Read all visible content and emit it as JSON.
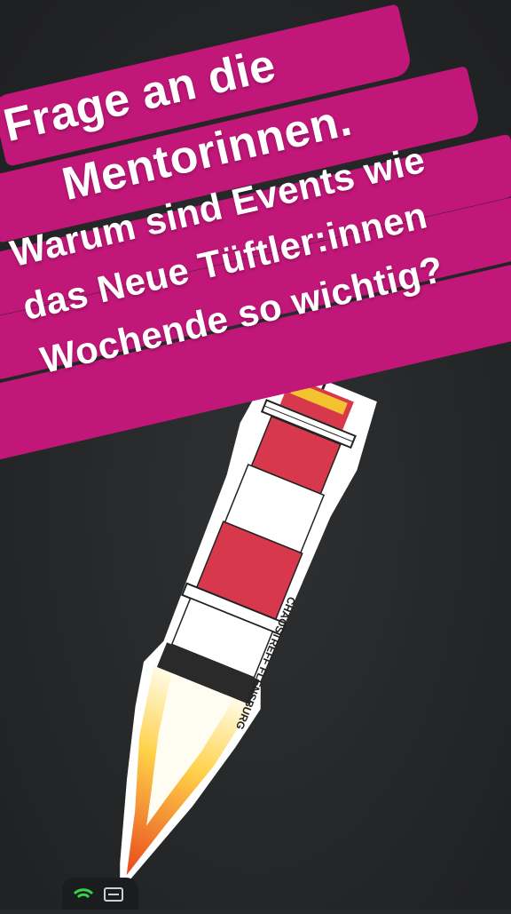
{
  "caption": {
    "title_line_1": "Frage an die",
    "title_line_2": "Mentorinnen.",
    "question_line_1": "Warum sind Events wie",
    "question_line_2": "das Neue Tüftler:innen",
    "question_line_3": "Wochende so wichtig?"
  },
  "sticker": {
    "icon": "rocket-lighthouse-sticker",
    "side_text": "CHAOSTREFF FLENSBURG"
  },
  "device_icons": {
    "left": "wifi-icon",
    "right": "screen-cast-icon"
  },
  "colors": {
    "brush": "#c01778",
    "background": "#26282a",
    "flame": "#f28a1e",
    "lighthouse_red": "#d8384c"
  }
}
